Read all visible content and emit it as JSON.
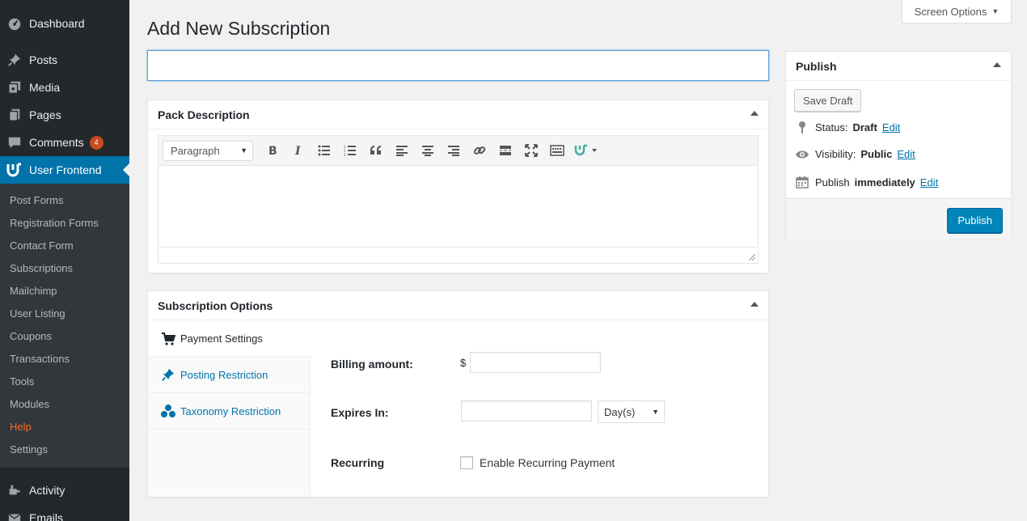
{
  "sidebar": {
    "top_items": [
      {
        "label": "Dashboard",
        "icon": "dashboard-icon"
      },
      {
        "label": "Posts",
        "icon": "pin-icon"
      },
      {
        "label": "Media",
        "icon": "media-icon"
      },
      {
        "label": "Pages",
        "icon": "pages-icon"
      },
      {
        "label": "Comments",
        "icon": "comment-icon",
        "badge": "4"
      },
      {
        "label": "User Frontend",
        "icon": "wpuf-logo-icon"
      }
    ],
    "submenu": [
      "Post Forms",
      "Registration Forms",
      "Contact Form",
      "Subscriptions",
      "Mailchimp",
      "User Listing",
      "Coupons",
      "Transactions",
      "Tools",
      "Modules",
      "Help",
      "Settings"
    ],
    "bottom_items": [
      {
        "label": "Activity",
        "icon": "activity-icon"
      },
      {
        "label": "Emails",
        "icon": "email-icon"
      }
    ]
  },
  "header": {
    "title": "Add New Subscription",
    "screen_options": "Screen Options"
  },
  "title_input": {
    "value": "",
    "placeholder": ""
  },
  "pack_description": {
    "title": "Pack Description",
    "format_select": "Paragraph"
  },
  "subscription_options": {
    "title": "Subscription Options",
    "tabs": [
      "Payment Settings",
      "Posting Restriction",
      "Taxonomy Restriction"
    ],
    "billing_label": "Billing amount:",
    "currency": "$",
    "expires_label": "Expires In:",
    "expires_unit": "Day(s)",
    "recurring_label": "Recurring",
    "recurring_checkbox": "Enable Recurring Payment"
  },
  "publish": {
    "title": "Publish",
    "save_draft": "Save Draft",
    "status_label": "Status:",
    "status_value": "Draft",
    "visibility_label": "Visibility:",
    "visibility_value": "Public",
    "publish_label": "Publish",
    "publish_value": "immediately",
    "edit": "Edit",
    "publish_button": "Publish"
  },
  "colors": {
    "sidebar_bg": "#23282d",
    "submenu_bg": "#32373c",
    "accent": "#0073aa",
    "primary_button": "#0085ba",
    "current_submenu": "#f56e28",
    "badge": "#ca4a1f"
  }
}
